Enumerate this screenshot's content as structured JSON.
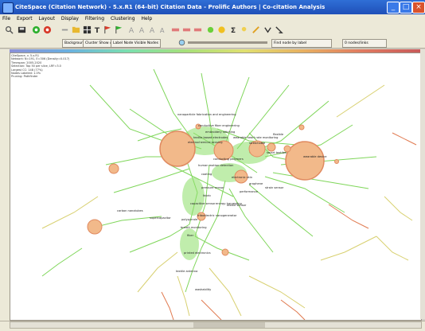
{
  "window": {
    "title": "CiteSpace (Citation Network) - 5.x.R1 (64-bit) Citation Data - Prolific Authors | Co-citation Analysis",
    "minimize": "_",
    "maximize": "□",
    "close": "×"
  },
  "menu": {
    "items": [
      "File",
      "Export",
      "Layout",
      "Display",
      "Filtering",
      "Clustering",
      "Help"
    ]
  },
  "toolbar": {
    "icons": [
      "search-icon",
      "save-icon",
      "green-circle-icon",
      "red-circle-icon",
      "pause-icon",
      "folder-icon",
      "grid-icon",
      "text-icon",
      "flag-red-icon",
      "flag-green-icon",
      "font-a-icon",
      "font-a-outline-icon",
      "font-a-alt-icon",
      "font-a-small-icon",
      "label-red-icon",
      "label-green-icon",
      "label-orange-icon",
      "sun-icon",
      "star-icon",
      "sigma-icon",
      "magnify-icon",
      "wand-icon",
      "arrow-icon",
      "settings-icon"
    ]
  },
  "controls": {
    "background_label": "Background",
    "cluster_label": "Cluster Show All",
    "label_label": "Label Node Visible Nodes",
    "search_placeholder": "",
    "search_text": "Find node by label",
    "status_label": "0 nodes/links"
  },
  "info": {
    "lines": [
      "CiteSpace, v. 5.x.R1",
      "Network: N=191, E=306 (Density=0.017)",
      "Timespan: 2005-2020",
      "Selection: Top 50 per slice, LRF=3.0",
      "Largest CC: 148 (77%)",
      "Nodes Labeled: 1.0%",
      "Pruning: Pathfinder"
    ]
  },
  "network": {
    "colors": {
      "node_outer": "#f2b98a",
      "node_inner": "#e08a60",
      "edge_green": "#7fd65a",
      "edge_yellow": "#d8d070",
      "edge_red": "#e07a50"
    },
    "labels": [
      "nanoparticle fabrication and engineering",
      "conductive fiber engineering",
      "embroidery stitching",
      "textile based electrodes",
      "electrochemical sensing",
      "wearable heart rate monitoring",
      "flexible",
      "stretchable",
      "smart textiles",
      "conducting polymers",
      "human motion detection",
      "wearable device",
      "coating",
      "electronic skin",
      "graphene",
      "pressure sensor",
      "performance",
      "strain sensor",
      "fabric",
      "energy harvesting",
      "textile sensor",
      "capacitive sensor",
      "polypyrrole",
      "triboelectric nanogenerator",
      "carbon nanotubes",
      "supercapacitor",
      "breath monitoring",
      "fiber",
      "printed electronics",
      "textile antenna",
      "washability"
    ]
  }
}
